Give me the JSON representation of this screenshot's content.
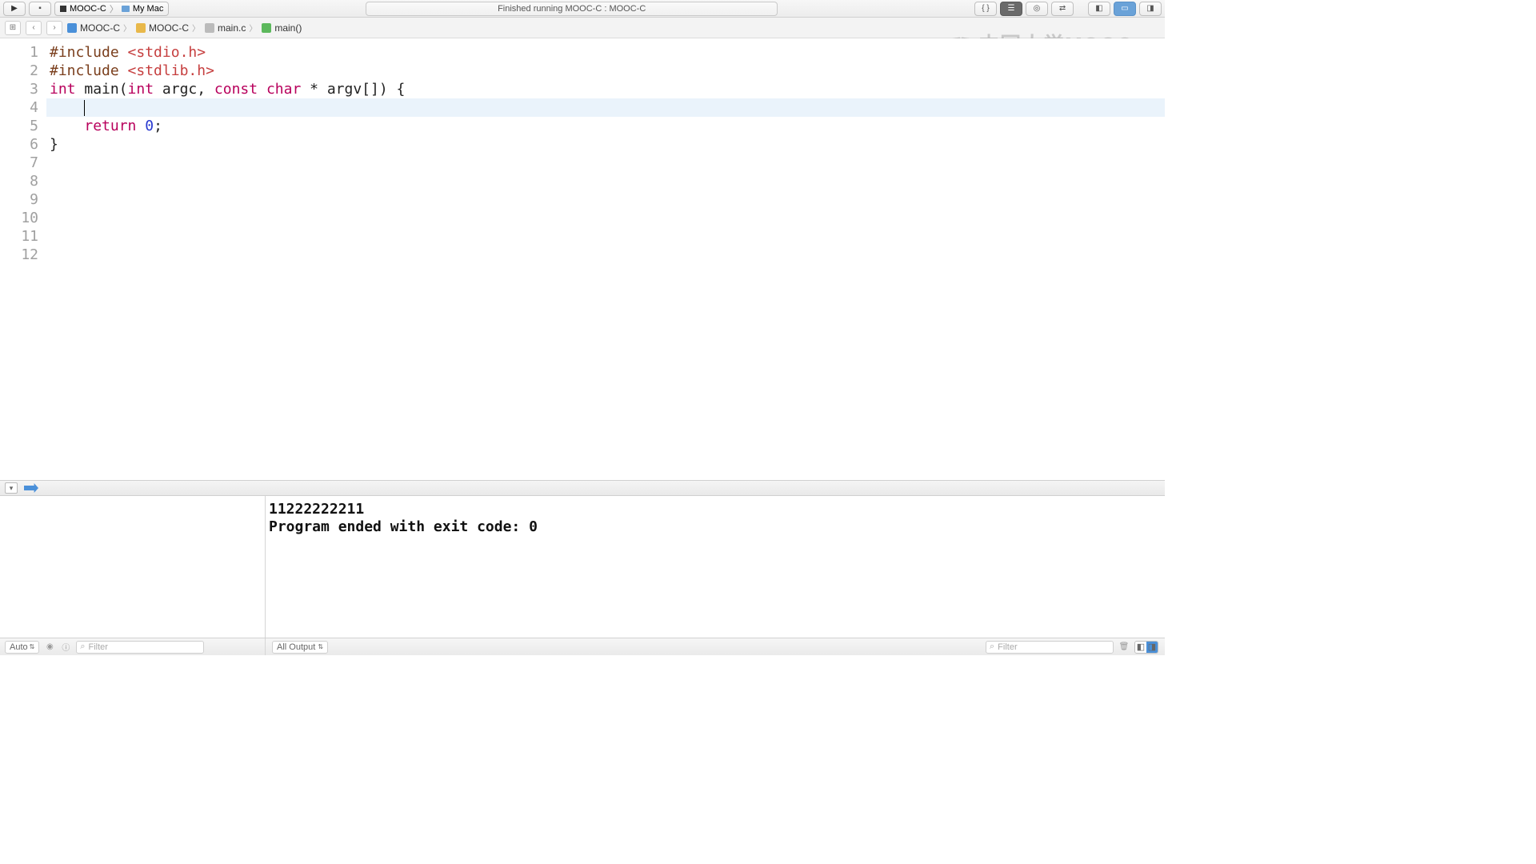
{
  "toolbar": {
    "scheme": "MOOC-C",
    "destination": "My Mac",
    "status": "Finished running MOOC-C : MOOC-C"
  },
  "pathbar": {
    "items": [
      {
        "label": "MOOC-C",
        "icon": "blue"
      },
      {
        "label": "MOOC-C",
        "icon": "yellow"
      },
      {
        "label": "main.c",
        "icon": "grey"
      },
      {
        "label": "main()",
        "icon": "green"
      }
    ]
  },
  "watermark": "中国大学MOOC",
  "editor": {
    "highlighted_line": 4,
    "line_count": 12,
    "lines": {
      "l1_pp": "#include ",
      "l1_inc": "<stdio.h>",
      "l2_pp": "#include ",
      "l2_inc": "<stdlib.h>",
      "l3_kw1": "int",
      "l3_sp1": " main(",
      "l3_kw2": "int",
      "l3_sp2": " argc, ",
      "l3_kw3": "const",
      "l3_sp3": " ",
      "l3_kw4": "char",
      "l3_sp4": " * argv[]) {",
      "l4": "    ",
      "l5_indent": "    ",
      "l5_kw": "return",
      "l5_sp": " ",
      "l5_num": "0",
      "l5_end": ";",
      "l6": "}"
    }
  },
  "console": {
    "line1": "11222222211",
    "line2": "Program ended with exit code: 0"
  },
  "footer": {
    "auto_label": "Auto",
    "filter_placeholder": "Filter",
    "output_label": "All Output",
    "right_filter_placeholder": "Filter"
  }
}
